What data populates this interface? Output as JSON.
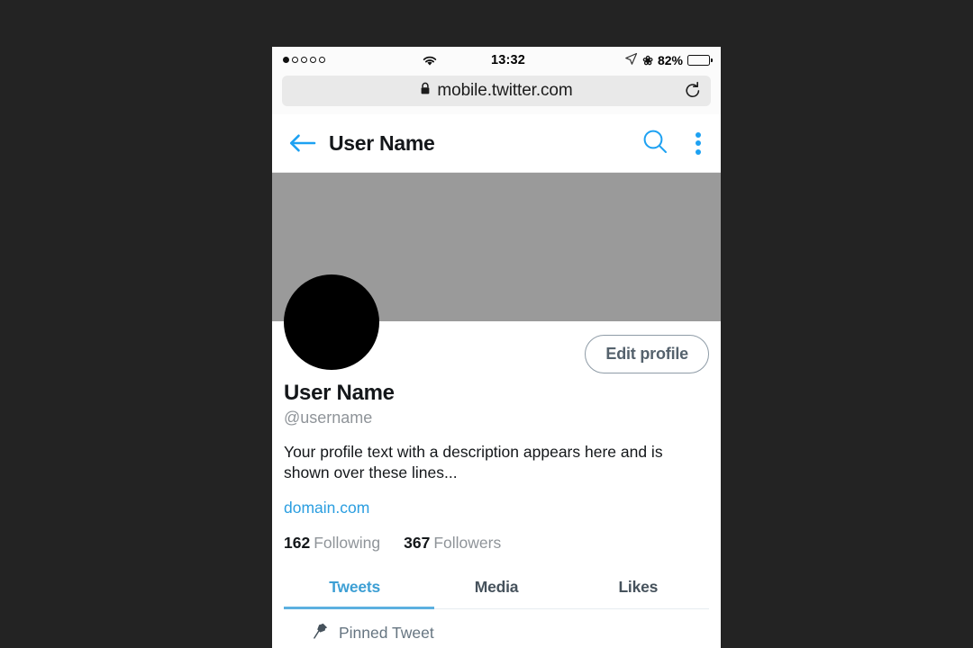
{
  "status_bar": {
    "signal_dots_total": 5,
    "signal_dots_filled": 1,
    "wifi_icon": "wifi-icon",
    "time": "13:32",
    "location_icon": "location-arrow-icon",
    "bluetooth_icon": "bluetooth-icon",
    "battery_percent": "82%",
    "battery_level": 82
  },
  "browser": {
    "lock_icon": "lock-icon",
    "url": "mobile.twitter.com",
    "reload_icon": "reload-icon"
  },
  "nav": {
    "back_icon": "back-arrow-icon",
    "title": "User Name",
    "search_icon": "search-icon",
    "overflow_icon": "overflow-menu-icon"
  },
  "profile": {
    "banner_color": "#9a9a9a",
    "avatar_color": "#000000",
    "edit_button": "Edit profile",
    "display_name": "User Name",
    "handle": "@username",
    "bio": "Your profile text with a description appears here and is shown over these lines...",
    "website": "domain.com",
    "stats": [
      {
        "count": "162",
        "label": "Following"
      },
      {
        "count": "367",
        "label": "Followers"
      }
    ]
  },
  "tabs": [
    {
      "label": "Tweets",
      "active": true
    },
    {
      "label": "Media",
      "active": false
    },
    {
      "label": "Likes",
      "active": false
    }
  ],
  "pinned": {
    "icon": "pin-icon",
    "label": "Pinned Tweet"
  },
  "colors": {
    "accent_blue": "#1da1f2",
    "tab_blue": "#3d9fd4",
    "link_blue": "#2b9ee0",
    "muted_gray": "#8f9499",
    "page_background": "#232323"
  }
}
